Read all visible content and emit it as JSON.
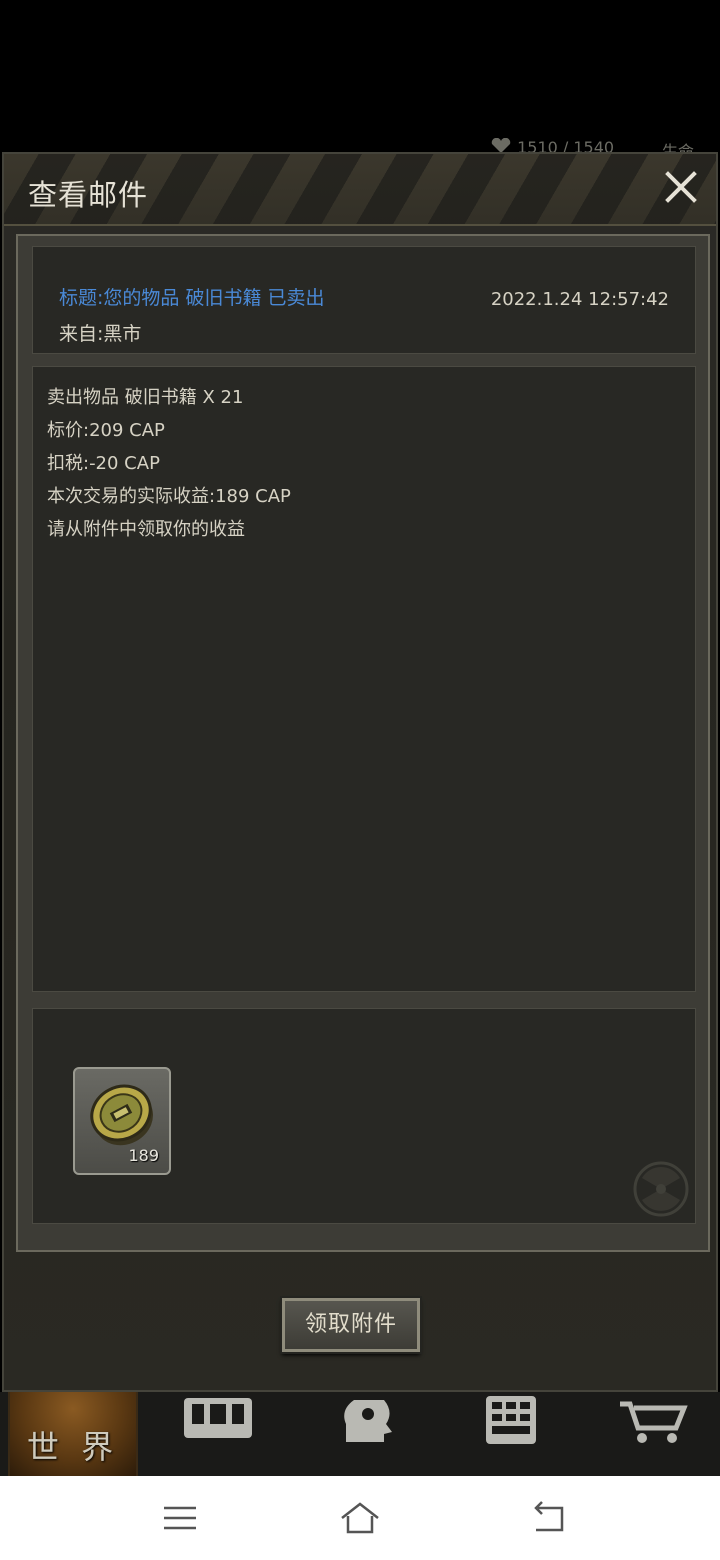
{
  "top_status": {
    "hp_text": "1510 / 1540",
    "life_text": "生命"
  },
  "modal": {
    "title": "查看邮件",
    "close_icon": "close-icon"
  },
  "mail": {
    "subject": "标题:您的物品 破旧书籍 已卖出",
    "from": "来自:黑市",
    "time": "2022.1.24 12:57:42",
    "body_lines": [
      "卖出物品 破旧书籍 X 21",
      "标价:209 CAP",
      "扣税:-20 CAP",
      "本次交易的实际收益:189 CAP",
      "请从附件中领取你的收益"
    ]
  },
  "attachment": {
    "icon": "bottle-cap-icon",
    "count": "189"
  },
  "claim_button_label": "领取附件",
  "game_nav": {
    "world_label": "世 界",
    "icons": [
      "backpack-icon",
      "head-gear-icon",
      "calculator-icon",
      "cart-icon"
    ]
  },
  "system_nav": [
    "menu-icon",
    "home-icon",
    "back-icon"
  ],
  "colors": {
    "subject_blue": "#4a89d6",
    "text_light": "#d6d2c4",
    "panel_dark": "#282824",
    "world_orange": "#8a5a22"
  }
}
